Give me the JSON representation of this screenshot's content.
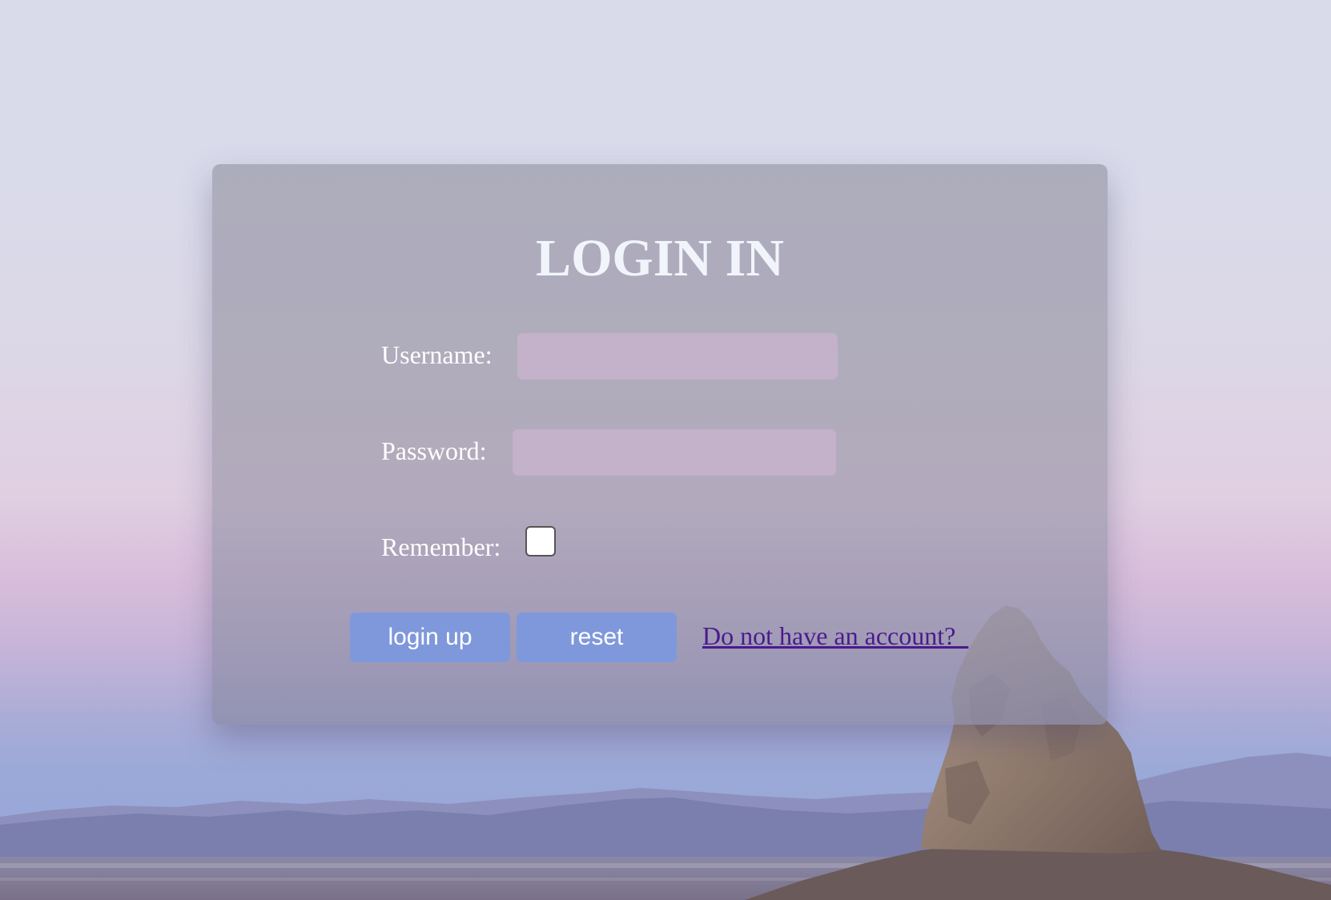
{
  "form": {
    "title": "LOGIN IN",
    "username_label": "Username:",
    "username_value": "",
    "password_label": "Password:",
    "password_value": "",
    "remember_label": "Remember:",
    "remember_checked": false,
    "login_button": "login up",
    "reset_button": "reset",
    "signup_link": "Do not have an account?  "
  },
  "colors": {
    "button": "#7f98db",
    "link": "#4b1a8c",
    "title": "#f1f5fb"
  },
  "background": {
    "scene": "desert-rock-pinnacle-at-dusk"
  }
}
